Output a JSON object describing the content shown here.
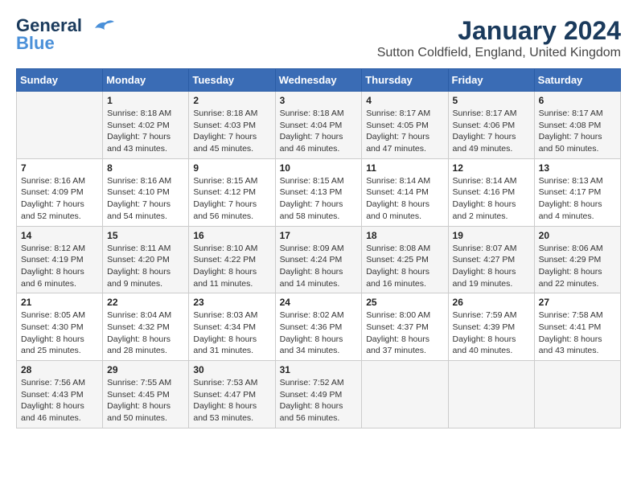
{
  "header": {
    "logo_line1": "General",
    "logo_line2": "Blue",
    "month": "January 2024",
    "location": "Sutton Coldfield, England, United Kingdom"
  },
  "days_of_week": [
    "Sunday",
    "Monday",
    "Tuesday",
    "Wednesday",
    "Thursday",
    "Friday",
    "Saturday"
  ],
  "weeks": [
    [
      {
        "day": "",
        "sunrise": "",
        "sunset": "",
        "daylight": ""
      },
      {
        "day": "1",
        "sunrise": "Sunrise: 8:18 AM",
        "sunset": "Sunset: 4:02 PM",
        "daylight": "Daylight: 7 hours and 43 minutes."
      },
      {
        "day": "2",
        "sunrise": "Sunrise: 8:18 AM",
        "sunset": "Sunset: 4:03 PM",
        "daylight": "Daylight: 7 hours and 45 minutes."
      },
      {
        "day": "3",
        "sunrise": "Sunrise: 8:18 AM",
        "sunset": "Sunset: 4:04 PM",
        "daylight": "Daylight: 7 hours and 46 minutes."
      },
      {
        "day": "4",
        "sunrise": "Sunrise: 8:17 AM",
        "sunset": "Sunset: 4:05 PM",
        "daylight": "Daylight: 7 hours and 47 minutes."
      },
      {
        "day": "5",
        "sunrise": "Sunrise: 8:17 AM",
        "sunset": "Sunset: 4:06 PM",
        "daylight": "Daylight: 7 hours and 49 minutes."
      },
      {
        "day": "6",
        "sunrise": "Sunrise: 8:17 AM",
        "sunset": "Sunset: 4:08 PM",
        "daylight": "Daylight: 7 hours and 50 minutes."
      }
    ],
    [
      {
        "day": "7",
        "sunrise": "Sunrise: 8:16 AM",
        "sunset": "Sunset: 4:09 PM",
        "daylight": "Daylight: 7 hours and 52 minutes."
      },
      {
        "day": "8",
        "sunrise": "Sunrise: 8:16 AM",
        "sunset": "Sunset: 4:10 PM",
        "daylight": "Daylight: 7 hours and 54 minutes."
      },
      {
        "day": "9",
        "sunrise": "Sunrise: 8:15 AM",
        "sunset": "Sunset: 4:12 PM",
        "daylight": "Daylight: 7 hours and 56 minutes."
      },
      {
        "day": "10",
        "sunrise": "Sunrise: 8:15 AM",
        "sunset": "Sunset: 4:13 PM",
        "daylight": "Daylight: 7 hours and 58 minutes."
      },
      {
        "day": "11",
        "sunrise": "Sunrise: 8:14 AM",
        "sunset": "Sunset: 4:14 PM",
        "daylight": "Daylight: 8 hours and 0 minutes."
      },
      {
        "day": "12",
        "sunrise": "Sunrise: 8:14 AM",
        "sunset": "Sunset: 4:16 PM",
        "daylight": "Daylight: 8 hours and 2 minutes."
      },
      {
        "day": "13",
        "sunrise": "Sunrise: 8:13 AM",
        "sunset": "Sunset: 4:17 PM",
        "daylight": "Daylight: 8 hours and 4 minutes."
      }
    ],
    [
      {
        "day": "14",
        "sunrise": "Sunrise: 8:12 AM",
        "sunset": "Sunset: 4:19 PM",
        "daylight": "Daylight: 8 hours and 6 minutes."
      },
      {
        "day": "15",
        "sunrise": "Sunrise: 8:11 AM",
        "sunset": "Sunset: 4:20 PM",
        "daylight": "Daylight: 8 hours and 9 minutes."
      },
      {
        "day": "16",
        "sunrise": "Sunrise: 8:10 AM",
        "sunset": "Sunset: 4:22 PM",
        "daylight": "Daylight: 8 hours and 11 minutes."
      },
      {
        "day": "17",
        "sunrise": "Sunrise: 8:09 AM",
        "sunset": "Sunset: 4:24 PM",
        "daylight": "Daylight: 8 hours and 14 minutes."
      },
      {
        "day": "18",
        "sunrise": "Sunrise: 8:08 AM",
        "sunset": "Sunset: 4:25 PM",
        "daylight": "Daylight: 8 hours and 16 minutes."
      },
      {
        "day": "19",
        "sunrise": "Sunrise: 8:07 AM",
        "sunset": "Sunset: 4:27 PM",
        "daylight": "Daylight: 8 hours and 19 minutes."
      },
      {
        "day": "20",
        "sunrise": "Sunrise: 8:06 AM",
        "sunset": "Sunset: 4:29 PM",
        "daylight": "Daylight: 8 hours and 22 minutes."
      }
    ],
    [
      {
        "day": "21",
        "sunrise": "Sunrise: 8:05 AM",
        "sunset": "Sunset: 4:30 PM",
        "daylight": "Daylight: 8 hours and 25 minutes."
      },
      {
        "day": "22",
        "sunrise": "Sunrise: 8:04 AM",
        "sunset": "Sunset: 4:32 PM",
        "daylight": "Daylight: 8 hours and 28 minutes."
      },
      {
        "day": "23",
        "sunrise": "Sunrise: 8:03 AM",
        "sunset": "Sunset: 4:34 PM",
        "daylight": "Daylight: 8 hours and 31 minutes."
      },
      {
        "day": "24",
        "sunrise": "Sunrise: 8:02 AM",
        "sunset": "Sunset: 4:36 PM",
        "daylight": "Daylight: 8 hours and 34 minutes."
      },
      {
        "day": "25",
        "sunrise": "Sunrise: 8:00 AM",
        "sunset": "Sunset: 4:37 PM",
        "daylight": "Daylight: 8 hours and 37 minutes."
      },
      {
        "day": "26",
        "sunrise": "Sunrise: 7:59 AM",
        "sunset": "Sunset: 4:39 PM",
        "daylight": "Daylight: 8 hours and 40 minutes."
      },
      {
        "day": "27",
        "sunrise": "Sunrise: 7:58 AM",
        "sunset": "Sunset: 4:41 PM",
        "daylight": "Daylight: 8 hours and 43 minutes."
      }
    ],
    [
      {
        "day": "28",
        "sunrise": "Sunrise: 7:56 AM",
        "sunset": "Sunset: 4:43 PM",
        "daylight": "Daylight: 8 hours and 46 minutes."
      },
      {
        "day": "29",
        "sunrise": "Sunrise: 7:55 AM",
        "sunset": "Sunset: 4:45 PM",
        "daylight": "Daylight: 8 hours and 50 minutes."
      },
      {
        "day": "30",
        "sunrise": "Sunrise: 7:53 AM",
        "sunset": "Sunset: 4:47 PM",
        "daylight": "Daylight: 8 hours and 53 minutes."
      },
      {
        "day": "31",
        "sunrise": "Sunrise: 7:52 AM",
        "sunset": "Sunset: 4:49 PM",
        "daylight": "Daylight: 8 hours and 56 minutes."
      },
      {
        "day": "",
        "sunrise": "",
        "sunset": "",
        "daylight": ""
      },
      {
        "day": "",
        "sunrise": "",
        "sunset": "",
        "daylight": ""
      },
      {
        "day": "",
        "sunrise": "",
        "sunset": "",
        "daylight": ""
      }
    ]
  ]
}
